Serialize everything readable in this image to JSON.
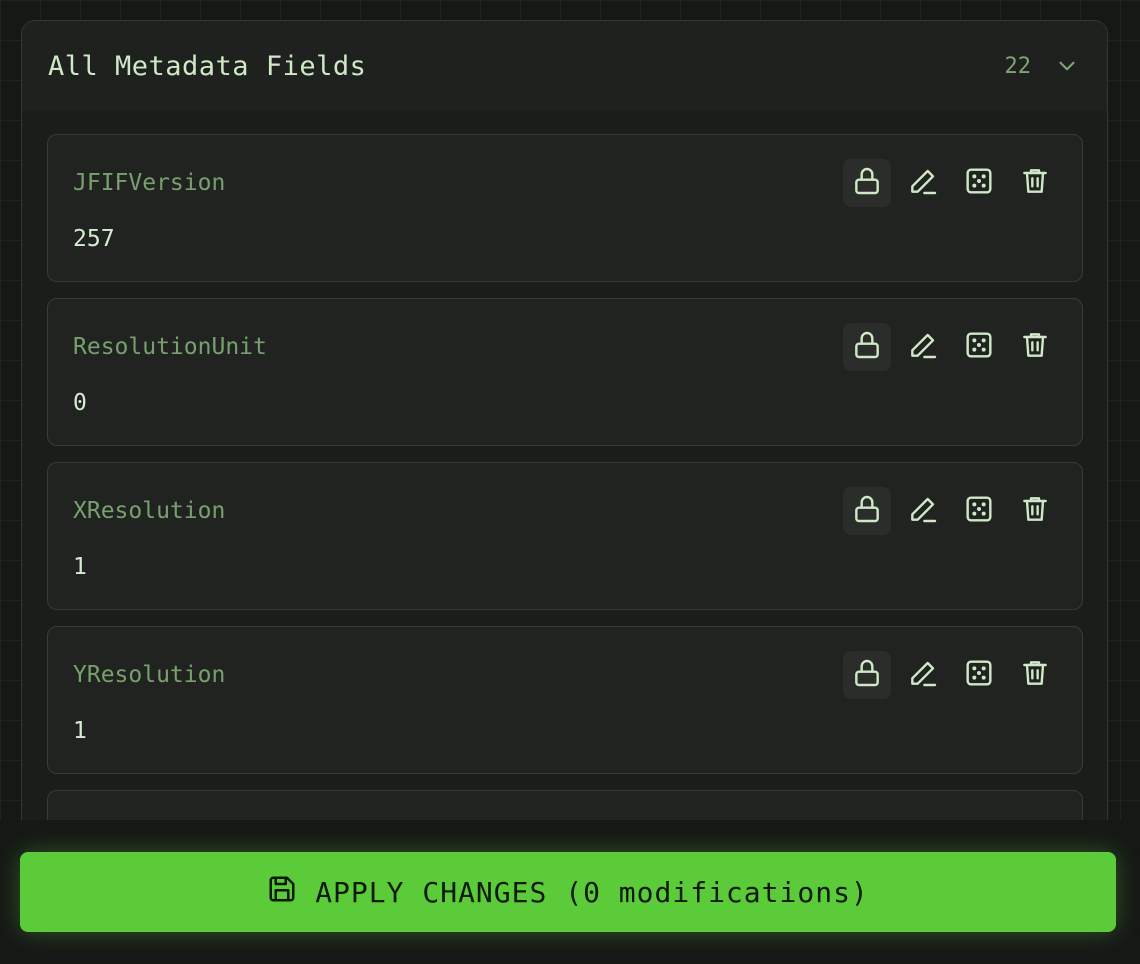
{
  "panel": {
    "title": "All Metadata Fields",
    "count": "22",
    "toggle_icon": "chevron-down-icon"
  },
  "fields": [
    {
      "name": "JFIFVersion",
      "value": "257"
    },
    {
      "name": "ResolutionUnit",
      "value": "0"
    },
    {
      "name": "XResolution",
      "value": "1"
    },
    {
      "name": "YResolution",
      "value": "1"
    }
  ],
  "field_actions": [
    "lock-icon",
    "pencil-icon",
    "dice-icon",
    "trash-icon"
  ],
  "apply": {
    "label": "APPLY CHANGES (0 modifications)",
    "icon": "save-icon"
  },
  "colors": {
    "accent": "#5ccb3a",
    "field_name": "#78a06f",
    "text": "#cfe9c8",
    "background": "#161816"
  }
}
